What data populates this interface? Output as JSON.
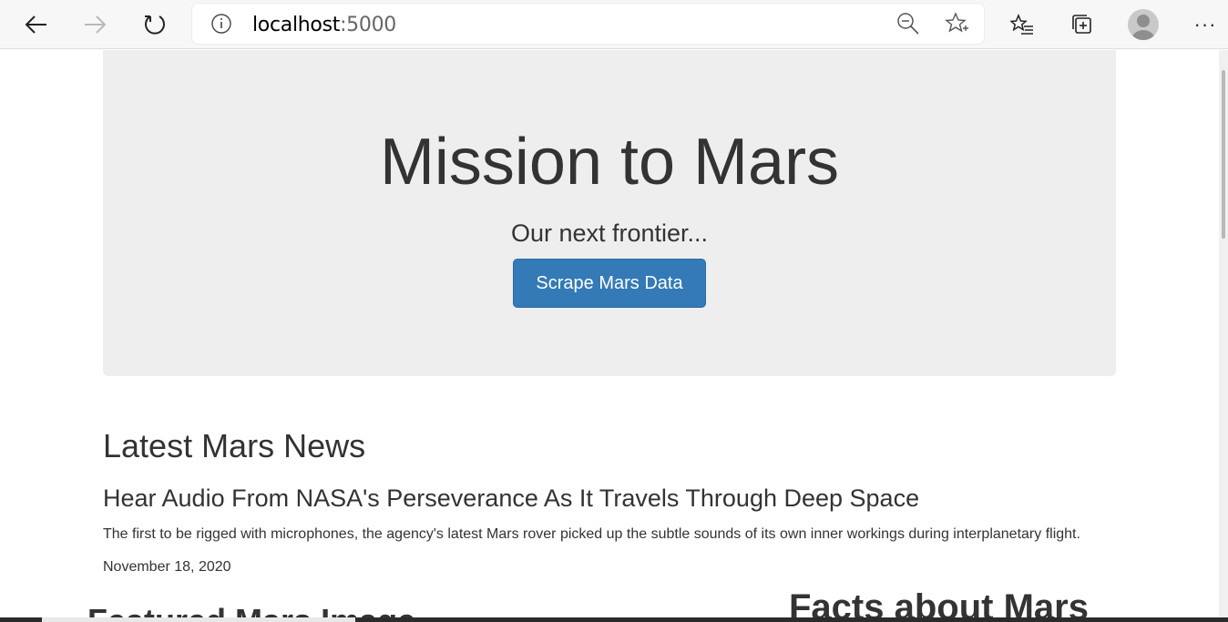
{
  "browser": {
    "url_host": "localhost",
    "url_port": ":5000",
    "icons": [
      "back-arrow-icon",
      "forward-arrow-icon",
      "refresh-icon",
      "info-icon",
      "zoom-out-icon",
      "add-favorite-icon",
      "favorites-icon",
      "collections-icon",
      "profile-avatar",
      "more-icon"
    ],
    "more_label": "···"
  },
  "jumbotron": {
    "title": "Mission to Mars",
    "subtitle": "Our next frontier...",
    "button_label": "Scrape Mars Data"
  },
  "news": {
    "heading": "Latest Mars News",
    "title": "Hear Audio From NASA's Perseverance As It Travels Through Deep Space",
    "paragraph": "The first to be rigged with microphones, the agency's latest Mars rover picked up the subtle sounds of its own inner workings during interplanetary flight.",
    "date": "November 18, 2020"
  },
  "featured": {
    "heading": "Featured Mars Image"
  },
  "facts": {
    "heading": "Facts about Mars"
  },
  "colors": {
    "button_bg": "#337ab7",
    "jumbotron_bg": "#eeeeee",
    "text": "#333333"
  }
}
